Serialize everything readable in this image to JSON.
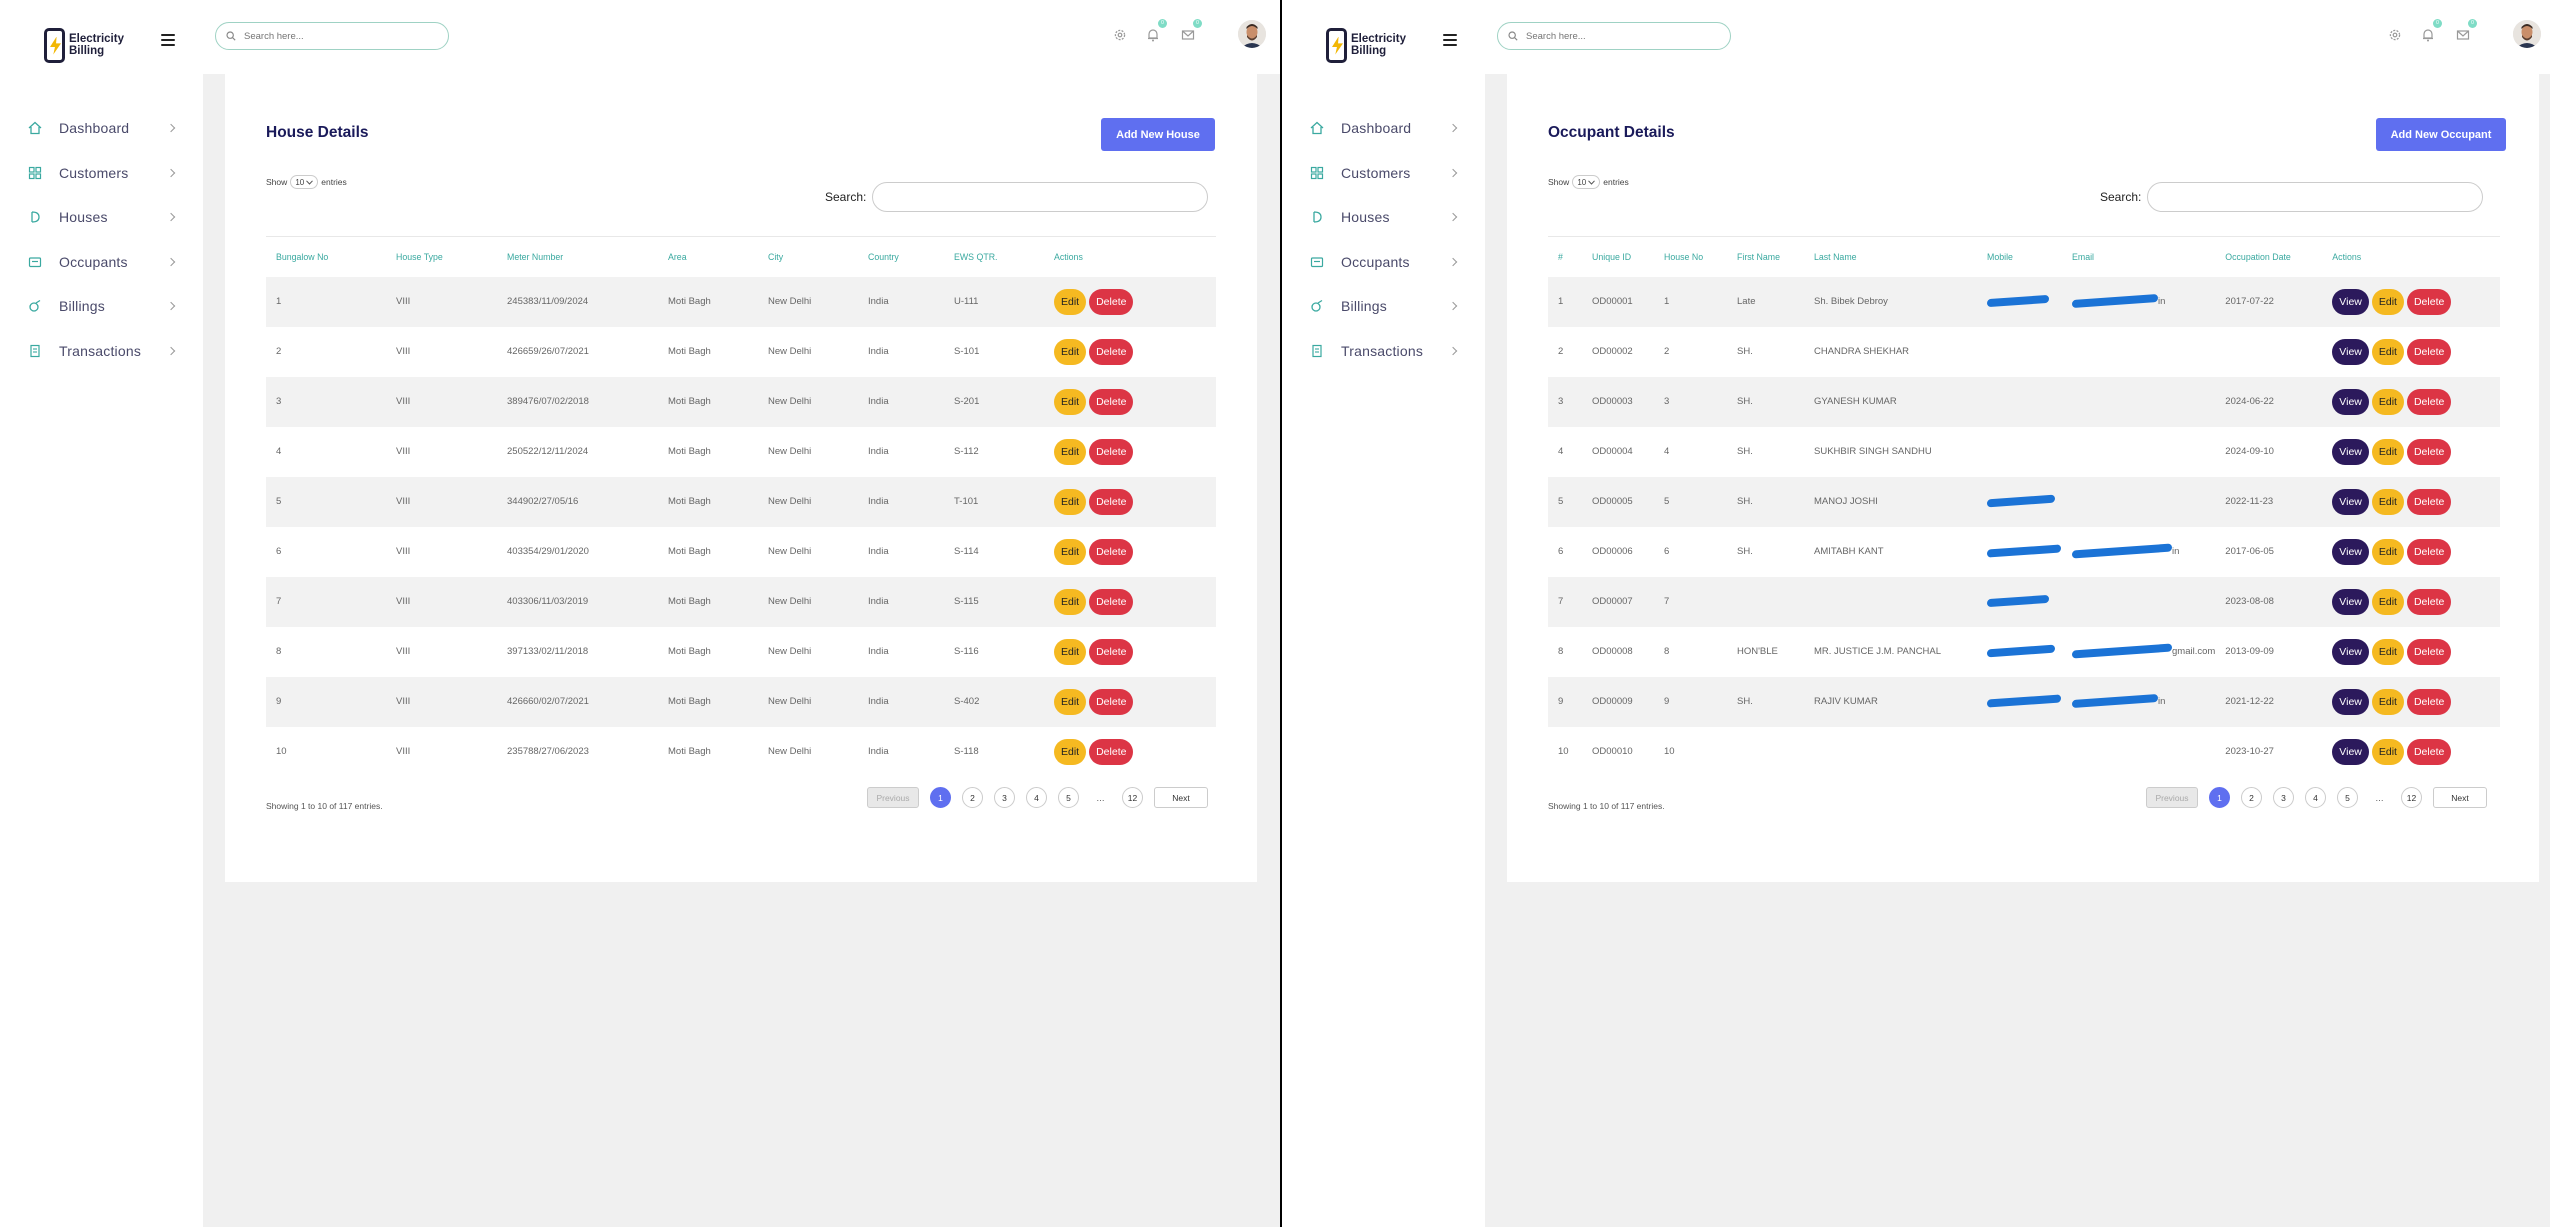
{
  "brand": {
    "line1": "Electricity",
    "line2": "Billing"
  },
  "nav": [
    {
      "label": "Dashboard",
      "icon": "home-icon"
    },
    {
      "label": "Customers",
      "icon": "grid-icon"
    },
    {
      "label": "Houses",
      "icon": "house-icon"
    },
    {
      "label": "Occupants",
      "icon": "occupant-icon"
    },
    {
      "label": "Billings",
      "icon": "billing-icon"
    },
    {
      "label": "Transactions",
      "icon": "transactions-icon"
    }
  ],
  "search": {
    "placeholder": "Search here..."
  },
  "badges": {
    "notifications": "0",
    "messages": "0"
  },
  "colors": {
    "accent": "#5f6ff0",
    "teal": "#3aa9a0",
    "edit": "#f5b921",
    "delete": "#dc3545",
    "view": "#2c1a5c"
  },
  "common": {
    "show": "Show",
    "entries": "entries",
    "page_size": "10",
    "search_label": "Search:",
    "info": "Showing 1 to 10 of 117 entries.",
    "edit": "Edit",
    "delete": "Delete",
    "view": "View",
    "pagination": {
      "prev": "Previous",
      "next": "Next",
      "pages": [
        "1",
        "2",
        "3",
        "4",
        "5"
      ],
      "dots": "…",
      "last": "12"
    }
  },
  "house": {
    "title": "House Details",
    "add": "Add New House",
    "headers": [
      "Bungalow No",
      "House Type",
      "Meter Number",
      "Area",
      "City",
      "Country",
      "EWS QTR.",
      "Actions"
    ],
    "rows": [
      [
        "1",
        "VIII",
        "245383/11/09/2024",
        "Moti Bagh",
        "New Delhi",
        "India",
        "U-111"
      ],
      [
        "2",
        "VIII",
        "426659/26/07/2021",
        "Moti Bagh",
        "New Delhi",
        "India",
        "S-101"
      ],
      [
        "3",
        "VIII",
        "389476/07/02/2018",
        "Moti Bagh",
        "New Delhi",
        "India",
        "S-201"
      ],
      [
        "4",
        "VIII",
        "250522/12/11/2024",
        "Moti Bagh",
        "New Delhi",
        "India",
        "S-112"
      ],
      [
        "5",
        "VIII",
        "344902/27/05/16",
        "Moti Bagh",
        "New Delhi",
        "India",
        "T-101"
      ],
      [
        "6",
        "VIII",
        "403354/29/01/2020",
        "Moti Bagh",
        "New Delhi",
        "India",
        "S-114"
      ],
      [
        "7",
        "VIII",
        "403306/11/03/2019",
        "Moti Bagh",
        "New Delhi",
        "India",
        "S-115"
      ],
      [
        "8",
        "VIII",
        "397133/02/11/2018",
        "Moti Bagh",
        "New Delhi",
        "India",
        "S-116"
      ],
      [
        "9",
        "VIII",
        "426660/02/07/2021",
        "Moti Bagh",
        "New Delhi",
        "India",
        "S-402"
      ],
      [
        "10",
        "VIII",
        "235788/27/06/2023",
        "Moti Bagh",
        "New Delhi",
        "India",
        "S-118"
      ]
    ]
  },
  "occupant": {
    "title": "Occupant Details",
    "add": "Add New Occupant",
    "headers": [
      "#",
      "Unique ID",
      "House No",
      "First Name",
      "Last Name",
      "Mobile",
      "Email",
      "Occupation Date",
      "Actions"
    ],
    "rows": [
      {
        "cells": [
          "1",
          "OD00001",
          "1",
          "Late",
          "Sh. Bibek Debroy"
        ],
        "mobile": "redacted",
        "email": "redacted",
        "email_tail": "in",
        "date": "2017-07-22"
      },
      {
        "cells": [
          "2",
          "OD00002",
          "2",
          "SH.",
          "CHANDRA SHEKHAR"
        ],
        "mobile": "",
        "email": "",
        "email_tail": "",
        "date": ""
      },
      {
        "cells": [
          "3",
          "OD00003",
          "3",
          "SH.",
          "GYANESH KUMAR"
        ],
        "mobile": "",
        "email": "",
        "email_tail": "",
        "date": "2024-06-22"
      },
      {
        "cells": [
          "4",
          "OD00004",
          "4",
          "SH.",
          "SUKHBIR SINGH SANDHU"
        ],
        "mobile": "",
        "email": "",
        "email_tail": "",
        "date": "2024-09-10"
      },
      {
        "cells": [
          "5",
          "OD00005",
          "5",
          "SH.",
          "MANOJ JOSHI"
        ],
        "mobile": "redacted",
        "email": "",
        "email_tail": "",
        "date": "2022-11-23"
      },
      {
        "cells": [
          "6",
          "OD00006",
          "6",
          "SH.",
          "AMITABH KANT"
        ],
        "mobile": "redacted",
        "email": "redacted",
        "email_tail": "in",
        "date": "2017-06-05"
      },
      {
        "cells": [
          "7",
          "OD00007",
          "7",
          "",
          ""
        ],
        "mobile": "redacted",
        "email": "",
        "email_tail": "",
        "date": "2023-08-08"
      },
      {
        "cells": [
          "8",
          "OD00008",
          "8",
          "HON'BLE",
          "MR. JUSTICE J.M. PANCHAL"
        ],
        "mobile": "redacted",
        "email": "redacted",
        "email_tail": "gmail.com",
        "date": "2013-09-09"
      },
      {
        "cells": [
          "9",
          "OD00009",
          "9",
          "SH.",
          "RAJIV KUMAR"
        ],
        "mobile": "redacted",
        "email": "redacted",
        "email_tail": "in",
        "date": "2021-12-22"
      },
      {
        "cells": [
          "10",
          "OD00010",
          "10",
          "",
          ""
        ],
        "mobile": "",
        "email": "",
        "email_tail": "",
        "date": "2023-10-27"
      }
    ]
  }
}
